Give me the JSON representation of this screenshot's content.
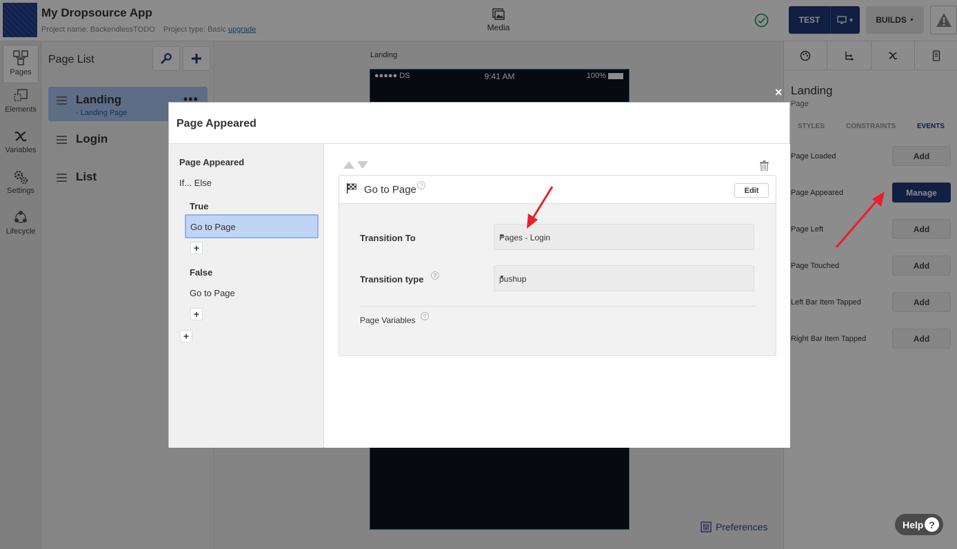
{
  "header": {
    "app_title": "My Dropsource App",
    "project_name_label": "Project name: BackendlessTODO",
    "project_type_label": "Project type: Basic",
    "upgrade_link": "upgrade",
    "media_label": "Media",
    "test_label": "TEST",
    "builds_label": "BUILDS",
    "status_color": "#2ca36b",
    "accent_color": "#1f3a78"
  },
  "rail": {
    "items": [
      {
        "label": "Pages",
        "icon": "pages-icon"
      },
      {
        "label": "Elements",
        "icon": "elements-icon"
      },
      {
        "label": "Variables",
        "icon": "variables-icon"
      },
      {
        "label": "Settings",
        "icon": "settings-icon"
      },
      {
        "label": "Lifecycle",
        "icon": "lifecycle-icon"
      }
    ]
  },
  "page_list": {
    "title": "Page List",
    "pages": [
      {
        "name": "Landing",
        "subtitle": "· Landing Page",
        "menu": "•••"
      },
      {
        "name": "Login"
      },
      {
        "name": "List"
      }
    ]
  },
  "canvas": {
    "label": "Landing",
    "status_carrier": "●●●●● DS",
    "status_time": "9:41 AM",
    "status_battery": "100%",
    "preferences_label": "Preferences"
  },
  "right_panel": {
    "title": "Landing",
    "subtitle": "Page",
    "subtabs": [
      "STYLES",
      "CONSTRAINTS",
      "EVENTS"
    ],
    "events": [
      {
        "label": "Page Loaded",
        "button": "Add"
      },
      {
        "label": "Page Appeared",
        "button": "Manage"
      },
      {
        "label": "Page Left",
        "button": "Add"
      },
      {
        "label": "Page Touched",
        "button": "Add"
      },
      {
        "label": "Left Bar Item Tapped",
        "button": "Add"
      },
      {
        "label": "Right Bar Item Tapped",
        "button": "Add"
      }
    ]
  },
  "modal": {
    "title": "Page Appeared",
    "close": "×",
    "tree": {
      "root": "Page Appeared",
      "if_else": "If... Else",
      "true_label": "True",
      "true_action": "Go to Page",
      "false_label": "False",
      "false_action": "Go to Page",
      "plus": "+"
    },
    "action": {
      "name": "Go to Page",
      "edit": "Edit",
      "transition_to_label": "Transition To",
      "transition_to_value": "Pages - Login",
      "transition_type_label": "Transition type",
      "transition_type_value": "pushup",
      "page_variables_label": "Page Variables",
      "help_glyph": "?"
    }
  },
  "help": {
    "label": "Help",
    "glyph": "?"
  }
}
